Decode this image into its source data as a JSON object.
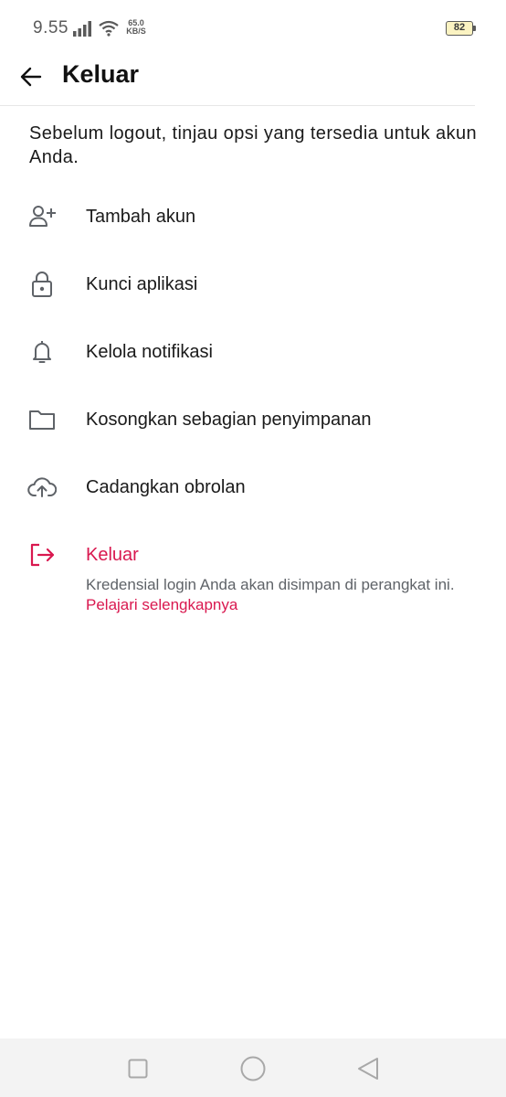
{
  "status_bar": {
    "time": "9.55",
    "net_speed_value": "65.0",
    "net_speed_unit": "KB/S",
    "battery_level": "82"
  },
  "header": {
    "title": "Keluar",
    "back_icon": "arrow-left-icon"
  },
  "intro_text": "Sebelum logout, tinjau opsi yang tersedia untuk akun Anda.",
  "options": [
    {
      "label": "Tambah akun",
      "icon": "add-person-icon"
    },
    {
      "label": "Kunci aplikasi",
      "icon": "lock-icon"
    },
    {
      "label": "Kelola notifikasi",
      "icon": "bell-icon"
    },
    {
      "label": "Kosongkan sebagian penyimpanan",
      "icon": "folder-icon"
    },
    {
      "label": "Cadangkan obrolan",
      "icon": "cloud-upload-icon"
    },
    {
      "label": "Keluar",
      "icon": "logout-icon"
    }
  ],
  "logout_description": "Kredensial login Anda akan disimpan di perangkat ini.",
  "learn_more": "Pelajari selengkapnya",
  "colors": {
    "accent": "#d9184f",
    "icon": "#5f6368",
    "text": "#1a1a1a"
  }
}
